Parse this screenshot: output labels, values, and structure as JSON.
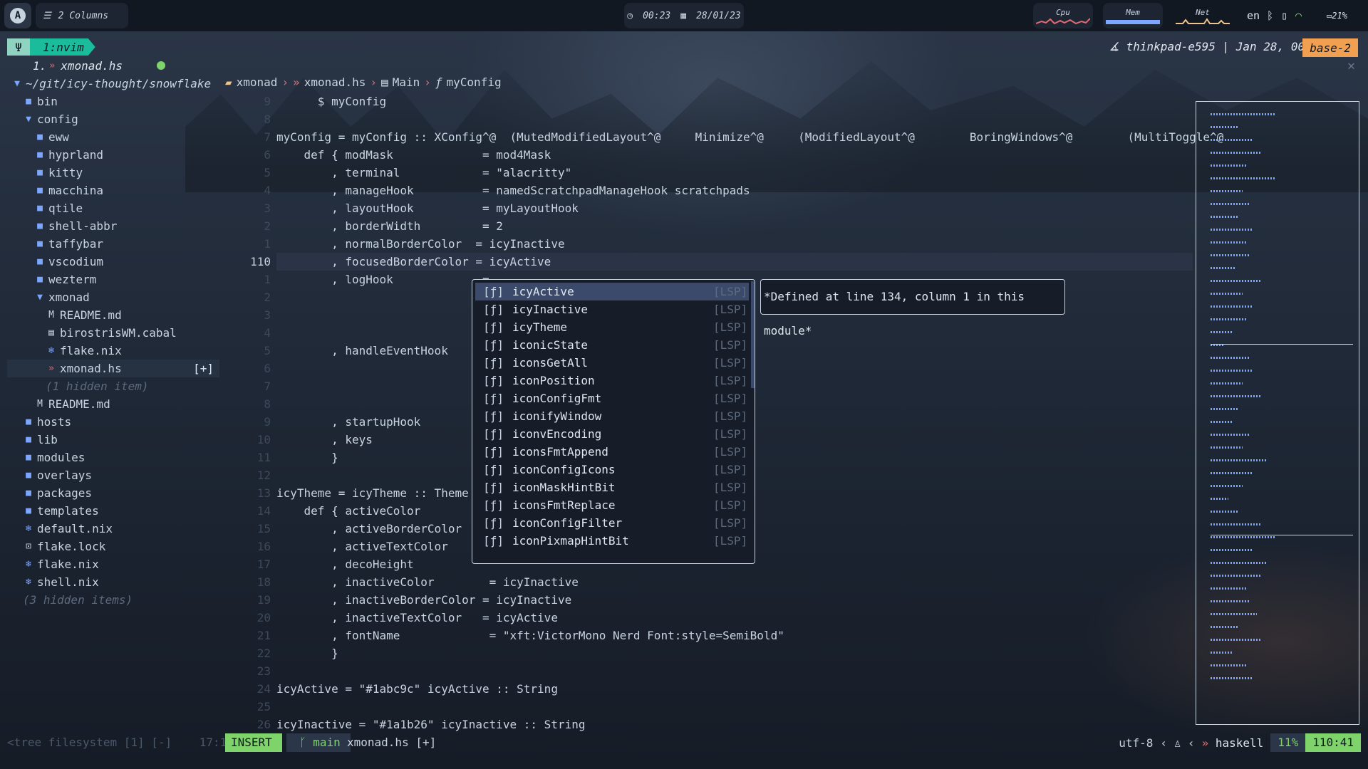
{
  "topbar": {
    "layout_label": "2 Columns",
    "time": "00:23",
    "date": "28/01/23",
    "cpu_label": "Cpu",
    "mem_label": "Mem",
    "net_label": "Net",
    "kbd_layout": "en",
    "battery": "21%"
  },
  "tmux": {
    "window": "1:nvim",
    "host_info": "thinkpad-e595 | Jan 28, 00:23",
    "session": "base-2"
  },
  "buffer_list": {
    "entry": "1. ",
    "file": "xmonad.hs"
  },
  "tree": {
    "root": "~/git/icy-thought/snowflake",
    "items": [
      {
        "name": "bin",
        "icon": "folder-icon",
        "level": 1
      },
      {
        "name": "config",
        "icon": "folder-open-icon",
        "level": 1
      },
      {
        "name": "eww",
        "icon": "folder-icon",
        "level": 2
      },
      {
        "name": "hyprland",
        "icon": "folder-icon",
        "level": 2
      },
      {
        "name": "kitty",
        "icon": "folder-icon",
        "level": 2
      },
      {
        "name": "macchina",
        "icon": "folder-icon",
        "level": 2
      },
      {
        "name": "qtile",
        "icon": "folder-icon",
        "level": 2
      },
      {
        "name": "shell-abbr",
        "icon": "folder-icon",
        "level": 2
      },
      {
        "name": "taffybar",
        "icon": "folder-icon",
        "level": 2
      },
      {
        "name": "vscodium",
        "icon": "folder-icon",
        "level": 2
      },
      {
        "name": "wezterm",
        "icon": "folder-icon",
        "level": 2
      },
      {
        "name": "xmonad",
        "icon": "folder-open-icon",
        "level": 2
      },
      {
        "name": "README.md",
        "icon": "markdown-icon",
        "level": 3
      },
      {
        "name": "birostrisWM.cabal",
        "icon": "file-icon",
        "level": 3
      },
      {
        "name": "flake.nix",
        "icon": "nix-icon",
        "level": 3
      },
      {
        "name": "xmonad.hs",
        "icon": "haskell-icon",
        "level": 3,
        "selected": true,
        "modified": "[+]"
      },
      {
        "name": "(1 hidden item)",
        "icon": "",
        "level": 3,
        "hidden": true
      },
      {
        "name": "README.md",
        "icon": "markdown-icon",
        "level": 2
      },
      {
        "name": "hosts",
        "icon": "folder-icon",
        "level": 1
      },
      {
        "name": "lib",
        "icon": "folder-icon",
        "level": 1
      },
      {
        "name": "modules",
        "icon": "folder-icon",
        "level": 1
      },
      {
        "name": "overlays",
        "icon": "folder-icon",
        "level": 1
      },
      {
        "name": "packages",
        "icon": "folder-icon",
        "level": 1
      },
      {
        "name": "templates",
        "icon": "folder-icon",
        "level": 1
      },
      {
        "name": "default.nix",
        "icon": "nix-icon",
        "level": 1
      },
      {
        "name": "flake.lock",
        "icon": "lock-icon",
        "level": 1
      },
      {
        "name": "flake.nix",
        "icon": "nix-icon",
        "level": 1
      },
      {
        "name": "shell.nix",
        "icon": "nix-icon",
        "level": 1
      },
      {
        "name": "(3 hidden items)",
        "icon": "",
        "level": 1,
        "hidden": true
      }
    ]
  },
  "winbar": {
    "folder": "xmonad",
    "file": "xmonad.hs",
    "module": "Main",
    "symbol": "myConfig"
  },
  "editor": {
    "lines": [
      {
        "n": "9",
        "text": "      $ myConfig"
      },
      {
        "n": "8",
        "text": ""
      },
      {
        "n": "7",
        "text": "myConfig = myConfig :: XConfig^@  (MutedModifiedLayout^@     Minimize^@     (ModifiedLayout^@        BoringWindows^@        (MultiToggle^@"
      },
      {
        "n": "6",
        "text": "    def { modMask             = mod4Mask"
      },
      {
        "n": "5",
        "text": "        , terminal            = \"alacritty\""
      },
      {
        "n": "4",
        "text": "        , manageHook          = namedScratchpadManageHook scratchpads"
      },
      {
        "n": "3",
        "text": "        , layoutHook          = myLayoutHook"
      },
      {
        "n": "2",
        "text": "        , borderWidth         = 2"
      },
      {
        "n": "1",
        "text": "        , normalBorderColor  = icyInactive"
      },
      {
        "n": "110",
        "text": "        , focusedBorderColor = icyActive"
      },
      {
        "n": "1",
        "text": "        , logHook             ="
      },
      {
        "n": "2",
        "text": ""
      },
      {
        "n": "3",
        "text": ""
      },
      {
        "n": "4",
        "text": ""
      },
      {
        "n": "5",
        "text": "        , handleEventHook     ="
      },
      {
        "n": "6",
        "text": ""
      },
      {
        "n": "7",
        "text": ""
      },
      {
        "n": "8",
        "text": ""
      },
      {
        "n": "9",
        "text": "        , startupHook         ="
      },
      {
        "n": "10",
        "text": "        , keys                ="
      },
      {
        "n": "11",
        "text": "        }"
      },
      {
        "n": "12",
        "text": ""
      },
      {
        "n": "13",
        "text": "icyTheme = icyTheme :: Theme"
      },
      {
        "n": "14",
        "text": "    def { activeColor"
      },
      {
        "n": "15",
        "text": "        , activeBorderColor"
      },
      {
        "n": "16",
        "text": "        , activeTextColor"
      },
      {
        "n": "17",
        "text": "        , decoHeight"
      },
      {
        "n": "18",
        "text": "        , inactiveColor        = icyInactive"
      },
      {
        "n": "19",
        "text": "        , inactiveBorderColor = icyInactive"
      },
      {
        "n": "20",
        "text": "        , inactiveTextColor   = icyActive"
      },
      {
        "n": "21",
        "text": "        , fontName             = \"xft:VictorMono Nerd Font:style=SemiBold\""
      },
      {
        "n": "22",
        "text": "        }"
      },
      {
        "n": "23",
        "text": ""
      },
      {
        "n": "24",
        "text": "icyActive = \"#1abc9c\" icyActive :: String"
      },
      {
        "n": "25",
        "text": ""
      },
      {
        "n": "26",
        "text": "icyInactive = \"#1a1b26\" icyInactive :: String"
      }
    ]
  },
  "completion": {
    "items": [
      {
        "kind": "[ƒ]",
        "name": "icyActive",
        "source": "[LSP]",
        "selected": true
      },
      {
        "kind": "[ƒ]",
        "name": "icyInactive",
        "source": "[LSP]"
      },
      {
        "kind": "[ƒ]",
        "name": "icyTheme",
        "source": "[LSP]"
      },
      {
        "kind": "[ƒ]",
        "name": "iconicState",
        "source": "[LSP]"
      },
      {
        "kind": "[ƒ]",
        "name": "iconsGetAll",
        "source": "[LSP]"
      },
      {
        "kind": "[ƒ]",
        "name": "iconPosition",
        "source": "[LSP]"
      },
      {
        "kind": "[ƒ]",
        "name": "iconConfigFmt",
        "source": "[LSP]"
      },
      {
        "kind": "[ƒ]",
        "name": "iconifyWindow",
        "source": "[LSP]"
      },
      {
        "kind": "[ƒ]",
        "name": "iconvEncoding",
        "source": "[LSP]"
      },
      {
        "kind": "[ƒ]",
        "name": "iconsFmtAppend",
        "source": "[LSP]"
      },
      {
        "kind": "[ƒ]",
        "name": "iconConfigIcons",
        "source": "[LSP]"
      },
      {
        "kind": "[ƒ]",
        "name": "iconMaskHintBit",
        "source": "[LSP]"
      },
      {
        "kind": "[ƒ]",
        "name": "iconsFmtReplace",
        "source": "[LSP]"
      },
      {
        "kind": "[ƒ]",
        "name": "iconConfigFilter",
        "source": "[LSP]"
      },
      {
        "kind": "[ƒ]",
        "name": "iconPixmapHintBit",
        "source": "[LSP]"
      }
    ],
    "doc": "*Defined at line 134, column 1 in this module*"
  },
  "statusline": {
    "tree_status": "<tree filesystem [1] [-]",
    "tree_pos": "17:1",
    "mode": "INSERT",
    "branch": "main",
    "file": "xmonad.hs [+]",
    "encoding": "utf-8",
    "filetype": "haskell",
    "percent": "11%",
    "position": "110:41"
  },
  "colors": {
    "accent": "#1abc9c",
    "insert_mode": "#7ed36a",
    "session_badge": "#f0a050"
  }
}
